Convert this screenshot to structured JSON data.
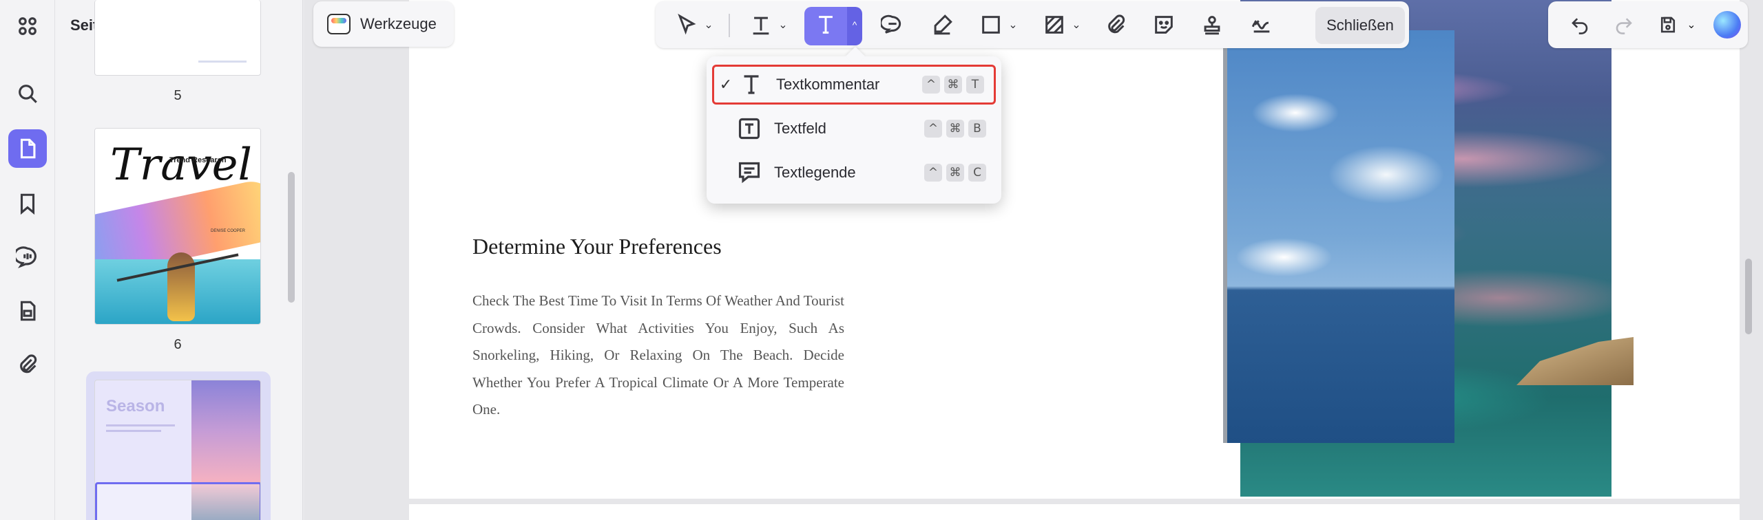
{
  "thumbnail_panel": {
    "title": "Seitenminiaturen",
    "pages": [
      {
        "number": "5"
      },
      {
        "number": "6",
        "title_script": "Travel",
        "subtitle": "Trend Research",
        "author": "DENISE COOPER"
      },
      {
        "title": "Season"
      }
    ]
  },
  "toolbar": {
    "tools_label": "Werkzeuge",
    "close_label": "Schließen"
  },
  "text_menu": {
    "items": [
      {
        "label": "Textkommentar",
        "checked": "✓",
        "keys": [
          "^",
          "⌘",
          "T"
        ]
      },
      {
        "label": "Textfeld",
        "checked": "",
        "keys": [
          "^",
          "⌘",
          "B"
        ]
      },
      {
        "label": "Textlegende",
        "checked": "",
        "keys": [
          "^",
          "⌘",
          "C"
        ]
      }
    ]
  },
  "document": {
    "heading": "Determine Your Preferences",
    "body": "Check The Best Time To Visit In Terms Of Weather And Tourist Crowds. Consider What Activities You Enjoy, Such As Snorkeling, Hiking, Or Relaxing On The Beach. Decide Whether You Prefer A Tropical Climate Or A More Temperate One."
  },
  "colors": {
    "accent": "#7b78f2",
    "highlight_border": "#e43b36"
  }
}
